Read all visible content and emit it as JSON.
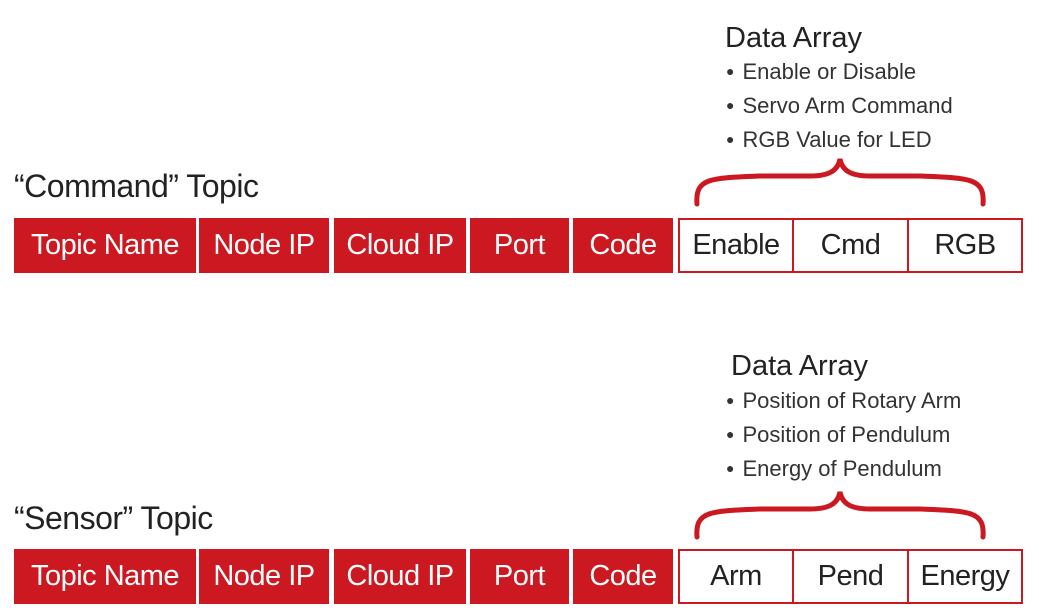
{
  "command": {
    "title": "“Command” Topic",
    "data_array": {
      "heading": "Data Array",
      "bullets": [
        "Enable or Disable",
        "Servo Arm Command",
        "RGB Value for LED"
      ]
    },
    "header_fields": [
      "Topic Name",
      "Node IP",
      "Cloud IP",
      "Port",
      "Code"
    ],
    "data_fields": [
      "Enable",
      "Cmd",
      "RGB"
    ]
  },
  "sensor": {
    "title": "“Sensor” Topic",
    "data_array": {
      "heading": "Data Array",
      "bullets": [
        "Position of Rotary Arm",
        "Position of Pendulum",
        "Energy of Pendulum"
      ]
    },
    "header_fields": [
      "Topic Name",
      "Node IP",
      "Cloud IP",
      "Port",
      "Code"
    ],
    "data_fields": [
      "Arm",
      "Pend",
      "Energy"
    ]
  },
  "colors": {
    "accent": "#cc1820",
    "text": "#222222"
  }
}
